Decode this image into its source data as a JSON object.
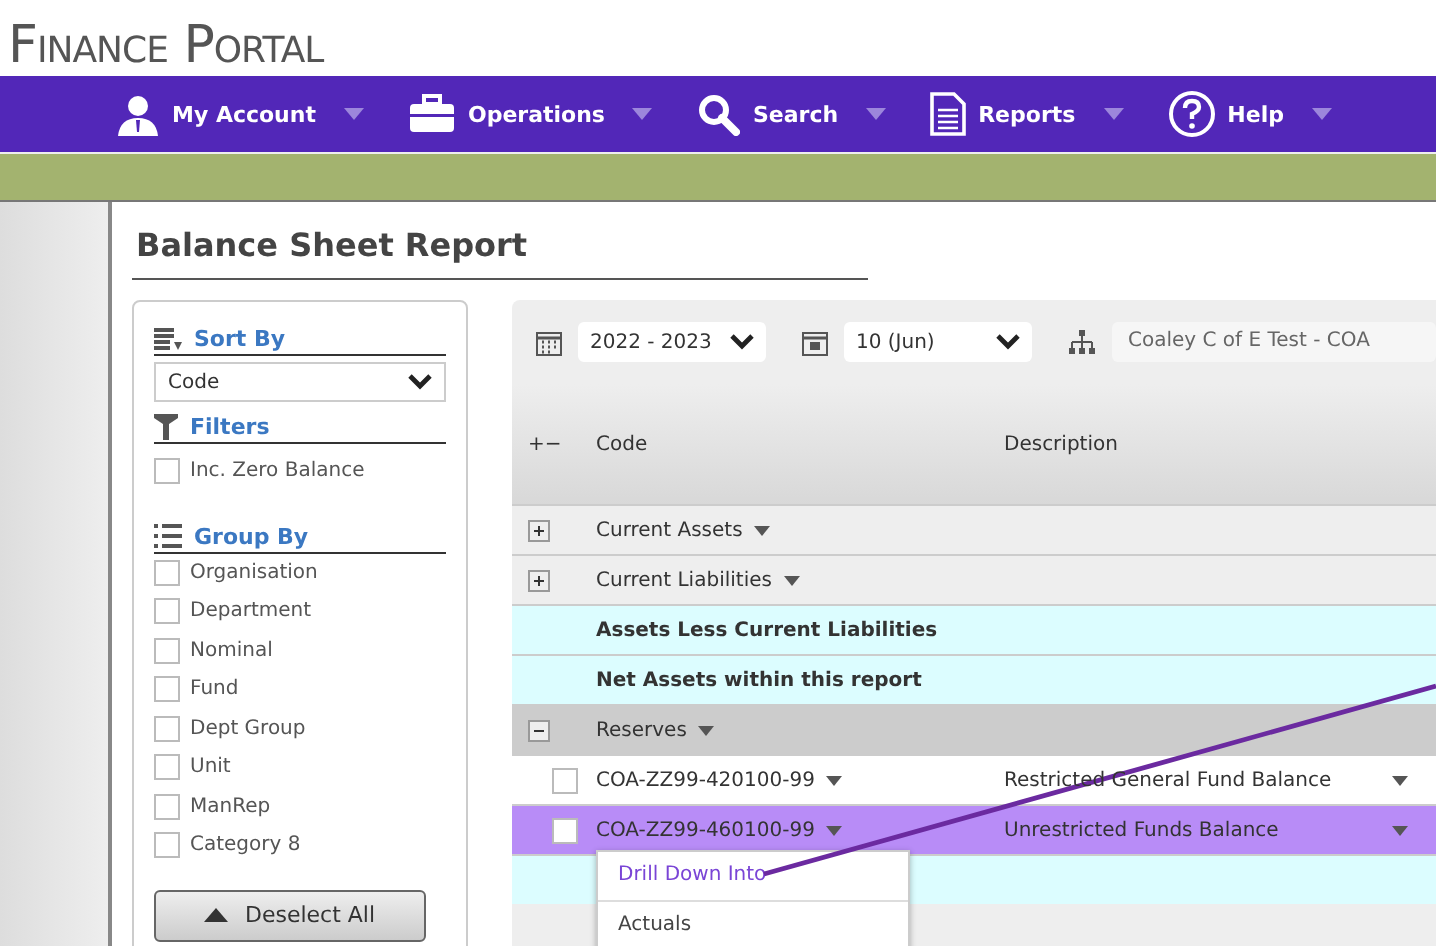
{
  "app_title": "Finance Portal",
  "nav": [
    {
      "label": "My Account"
    },
    {
      "label": "Operations"
    },
    {
      "label": "Search"
    },
    {
      "label": "Reports"
    },
    {
      "label": "Help"
    }
  ],
  "page_title": "Balance Sheet Report",
  "sidebar": {
    "sort_by": {
      "heading": "Sort By",
      "value": "Code"
    },
    "filters": {
      "heading": "Filters",
      "items": [
        {
          "label": "Inc. Zero Balance",
          "checked": false
        }
      ]
    },
    "group_by": {
      "heading": "Group By",
      "items": [
        {
          "label": "Organisation",
          "checked": false
        },
        {
          "label": "Department",
          "checked": false
        },
        {
          "label": "Nominal",
          "checked": false
        },
        {
          "label": "Fund",
          "checked": false
        },
        {
          "label": "Dept Group",
          "checked": false
        },
        {
          "label": "Unit",
          "checked": false
        },
        {
          "label": "ManRep",
          "checked": false
        },
        {
          "label": "Category 8",
          "checked": false
        }
      ]
    },
    "deselect_button": "Deselect All"
  },
  "toolbar": {
    "year": "2022 - 2023",
    "period": "10 (Jun)",
    "structure": "Coaley C of E Test - COA"
  },
  "table": {
    "expand_header": "+−",
    "columns": [
      "Code",
      "Description"
    ],
    "rows": [
      {
        "kind": "group",
        "label": "Current Assets",
        "expanded": false
      },
      {
        "kind": "group",
        "label": "Current Liabilities",
        "expanded": false
      },
      {
        "kind": "total",
        "label": "Assets Less Current Liabilities"
      },
      {
        "kind": "total",
        "label": "Net Assets within this report"
      },
      {
        "kind": "group",
        "label": "Reserves",
        "expanded": true
      },
      {
        "kind": "account",
        "code": "COA-ZZ99-420100-99",
        "description": "Restricted General Fund Balance",
        "checked": false,
        "selected": false
      },
      {
        "kind": "account",
        "code": "COA-ZZ99-460100-99",
        "description": "Unrestricted Funds Balance",
        "checked": false,
        "selected": true
      },
      {
        "kind": "total"
      }
    ]
  },
  "context_menu": [
    {
      "label": "Drill Down Into",
      "selected": true
    },
    {
      "label": "Actuals",
      "selected": false
    }
  ]
}
